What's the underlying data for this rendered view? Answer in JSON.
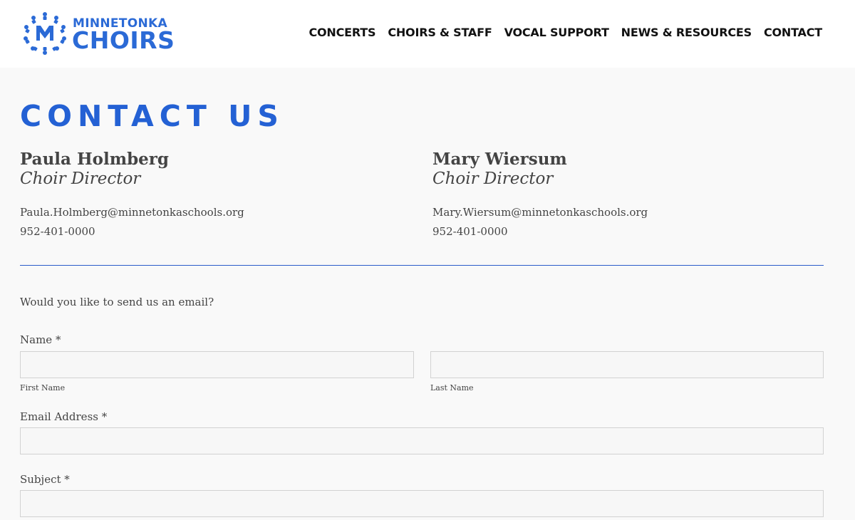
{
  "header": {
    "logo": {
      "line1": "MINNETONKA",
      "line2": "CHOIRS"
    },
    "nav": [
      {
        "label": "CONCERTS"
      },
      {
        "label": "CHOIRS & STAFF"
      },
      {
        "label": "VOCAL SUPPORT"
      },
      {
        "label": "NEWS & RESOURCES"
      },
      {
        "label": "CONTACT"
      }
    ]
  },
  "page": {
    "title": "CONTACT US",
    "contacts": [
      {
        "name": "Paula Holmberg",
        "role": "Choir Director",
        "email": "Paula.Holmberg@minnetonkaschools.org",
        "phone": "952-401-0000"
      },
      {
        "name": "Mary Wiersum",
        "role": "Choir Director",
        "email": "Mary.Wiersum@minnetonkaschools.org",
        "phone": "952-401-0000"
      }
    ],
    "intro": "Would you like to send us an email?"
  },
  "form": {
    "name_label": "Name",
    "first_name_sublabel": "First Name",
    "last_name_sublabel": "Last Name",
    "email_label": "Email Address",
    "subject_label": "Subject",
    "required_marker": "*",
    "first_name_value": "",
    "last_name_value": "",
    "email_value": "",
    "subject_value": ""
  },
  "colors": {
    "brand_blue": "#2461d4",
    "divider_blue": "#2b5cc9",
    "header_bg": "#ffffff",
    "page_bg": "#f9f9f9"
  },
  "icons": {
    "logo_mark": "choir-people-circle-logo-icon"
  }
}
